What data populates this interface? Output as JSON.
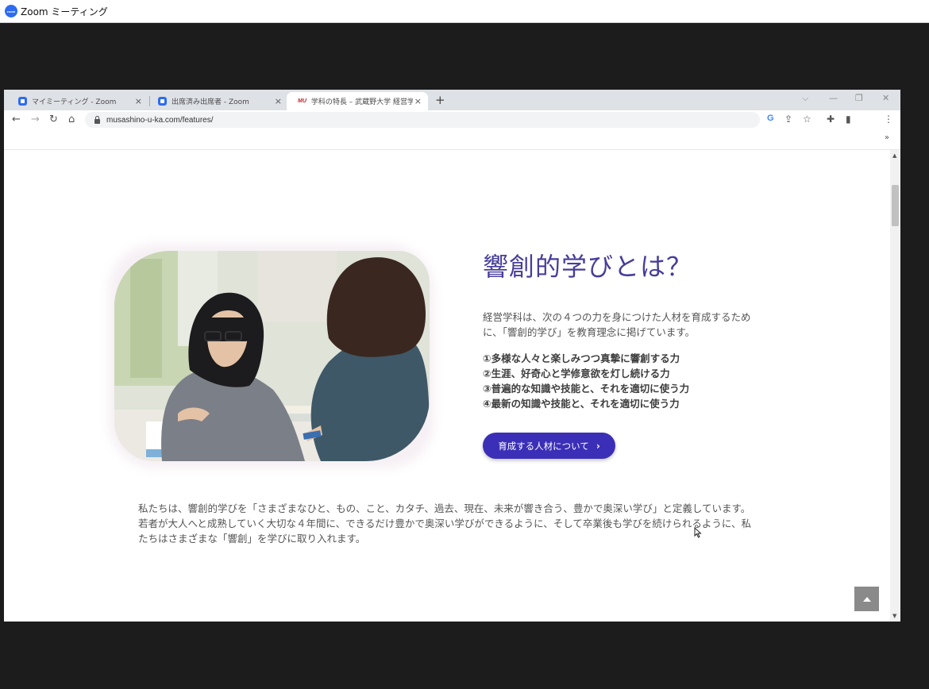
{
  "zoom": {
    "title": "Zoom ミーティング",
    "logo": "zoom"
  },
  "browser": {
    "tabs": [
      {
        "label": "マイミーティング - Zoom",
        "close": "×",
        "favicon": "zoom-favicon"
      },
      {
        "label": "出席済み出席者 - Zoom",
        "close": "×",
        "favicon": "zoom-favicon"
      },
      {
        "label": "学科の特長 – 武蔵野大学 経営学",
        "close": "×",
        "favicon": "mu-favicon",
        "favicon_text": "MU",
        "active": true
      }
    ],
    "new_tab": "+",
    "window_controls": {
      "dropdown": "⌵",
      "minimize": "—",
      "restore": "❐",
      "close": "✕"
    },
    "url": "musashino-u-ka.com/features/",
    "bookmark_overflow": "»",
    "nav": {
      "back": "←",
      "forward": "→",
      "reload": "↻",
      "home": "⌂"
    },
    "toolbar_icons": {
      "google": "G",
      "share": "⇪",
      "star": "☆",
      "extensions": "✚",
      "sidepanel": "▮",
      "menu": "⋮"
    }
  },
  "page": {
    "heading": "響創的学びとは？",
    "lead": "経営学科は、次の４つの力を身につけた人材を育成するために、「響創的学び」を教育理念に掲げています。",
    "points": [
      "①多様な人々と楽しみつつ真摯に響創する力",
      "②生涯、好奇心と学修意欲を灯し続ける力",
      "③普遍的な知識や技能と、それを適切に使う力",
      "④最新の知識や技能と、それを適切に使う力"
    ],
    "cta_label": "育成する人材について",
    "cta_chevron": "›",
    "body": "私たちは、響創的学びを「さまざまなひと、もの、こと、カタチ、過去、現在、未来が響き合う、豊かで奥深い学び」と定義しています。若者が大人へと成熟していく大切な４年間に、できるだけ豊かで奥深い学びができるように、そして卒業後も学びを続けられるように、私たちはさまざまな「響創」を学びに取り入れます。"
  },
  "colors": {
    "accent": "#3b2fb8",
    "heading": "#463d9a",
    "zoom_blue": "#2d6cf0"
  }
}
